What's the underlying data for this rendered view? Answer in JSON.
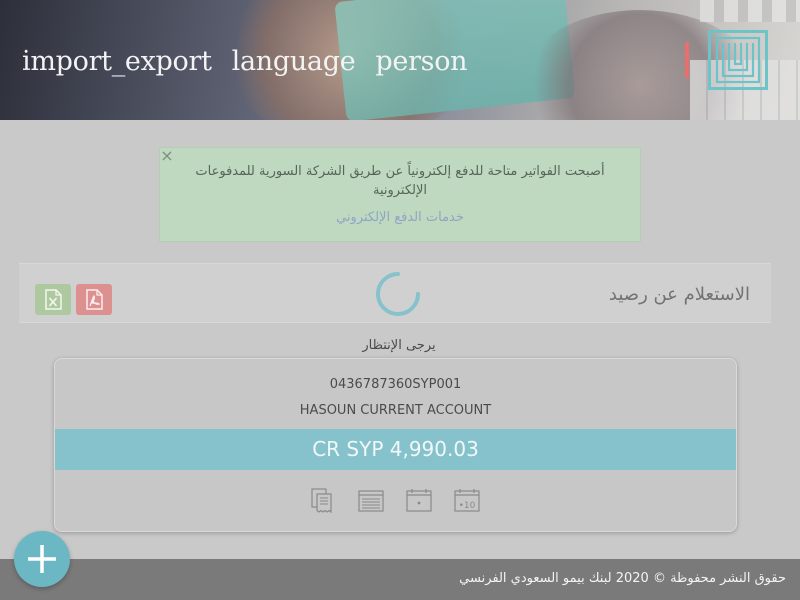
{
  "header": {
    "nav_items": [
      "import_export",
      "language",
      "person"
    ]
  },
  "alert": {
    "message": "أصبحت الفواتير متاحة للدفع إلكترونياً عن طريق الشركة السورية للمدفوعات الإلكترونية",
    "link": "خدمات الدفع الإلكتروني",
    "close": "×"
  },
  "panel": {
    "title": "الاستعلام عن رصيد",
    "wait_text": "يرجى الإنتظار"
  },
  "account": {
    "number": "0436787360SYP001",
    "name": "HASOUN CURRENT ACCOUNT",
    "balance": "CR SYP 4,990.03"
  },
  "footer": {
    "copyright": "حقوق النشر محفوظة © 2020 لبنك بيمو السعودي الفرنسي"
  },
  "colors": {
    "accent": "#86c2cb",
    "alert_bg": "#bfd8c0",
    "excel": "#aec99f",
    "pdf": "#dc9090",
    "header_bar": "#e96f6f"
  },
  "icons": [
    "excel-icon",
    "pdf-icon",
    "receipt-icon",
    "statement-icon",
    "calendar-icon",
    "cheque-icon",
    "plus-icon",
    "bank-logo"
  ]
}
